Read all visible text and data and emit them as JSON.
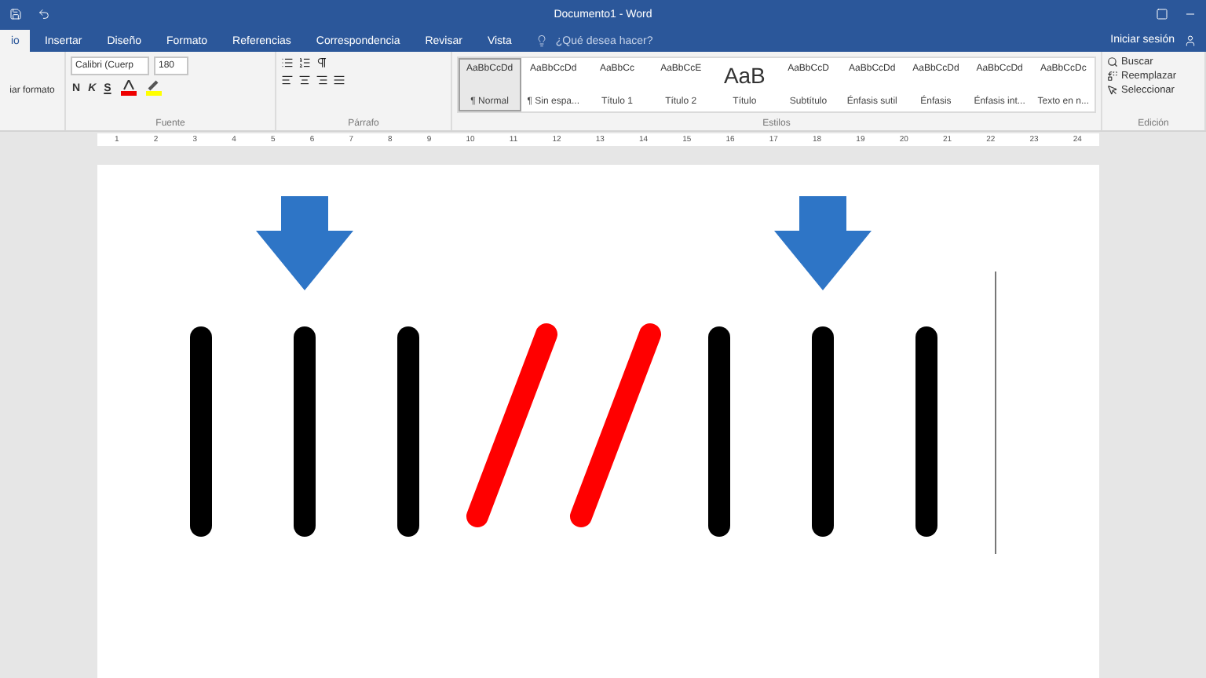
{
  "window": {
    "title": "Documento1 - Word"
  },
  "tabs": [
    {
      "label": "io",
      "selected": true
    },
    {
      "label": "Insertar",
      "selected": false
    },
    {
      "label": "Diseño",
      "selected": false
    },
    {
      "label": "Formato",
      "selected": false
    },
    {
      "label": "Referencias",
      "selected": false
    },
    {
      "label": "Correspondencia",
      "selected": false
    },
    {
      "label": "Revisar",
      "selected": false
    },
    {
      "label": "Vista",
      "selected": false
    }
  ],
  "tell_me": {
    "placeholder": "¿Qué desea hacer?"
  },
  "sign_in": "Iniciar sesión",
  "clipboard": {
    "copy_format": "iar formato"
  },
  "font": {
    "family": "Calibri (Cuerp",
    "size": "180",
    "bold": "N",
    "italic": "K",
    "underline": "S",
    "label": "Fuente"
  },
  "paragraph": {
    "label": "Párrafo"
  },
  "styles": {
    "label": "Estilos",
    "items": [
      {
        "preview": "AaBbCcDd",
        "name": "¶ Normal",
        "selected": true
      },
      {
        "preview": "AaBbCcDd",
        "name": "¶ Sin espa...",
        "selected": false
      },
      {
        "preview": "AaBbCc",
        "name": "Título 1",
        "selected": false
      },
      {
        "preview": "AaBbCcE",
        "name": "Título 2",
        "selected": false
      },
      {
        "preview": "AaB",
        "name": "Título",
        "selected": false
      },
      {
        "preview": "AaBbCcD",
        "name": "Subtítulo",
        "selected": false
      },
      {
        "preview": "AaBbCcDd",
        "name": "Énfasis sutil",
        "selected": false
      },
      {
        "preview": "AaBbCcDd",
        "name": "Énfasis",
        "selected": false
      },
      {
        "preview": "AaBbCcDd",
        "name": "Énfasis int...",
        "selected": false
      },
      {
        "preview": "AaBbCcDc",
        "name": "Texto en n...",
        "selected": false
      }
    ]
  },
  "editing": {
    "label": "Edición",
    "items": [
      "Buscar",
      "Reemplazar",
      "Seleccionar"
    ]
  },
  "ruler": [
    "1",
    "2",
    "3",
    "4",
    "5",
    "6",
    "7",
    "8",
    "9",
    "10",
    "11",
    "12",
    "13",
    "14",
    "15",
    "16",
    "17",
    "18",
    "19",
    "20",
    "21",
    "22",
    "23",
    "24"
  ],
  "marks": [
    {
      "kind": "upright",
      "color": "#000000",
      "arrow_above": false
    },
    {
      "kind": "upright",
      "color": "#000000",
      "arrow_above": true
    },
    {
      "kind": "upright",
      "color": "#000000",
      "arrow_above": false
    },
    {
      "kind": "slash",
      "color": "#ff0000",
      "arrow_above": false
    },
    {
      "kind": "slash",
      "color": "#ff0000",
      "arrow_above": false
    },
    {
      "kind": "upright",
      "color": "#000000",
      "arrow_above": false
    },
    {
      "kind": "upright",
      "color": "#000000",
      "arrow_above": true
    },
    {
      "kind": "upright",
      "color": "#000000",
      "arrow_above": false
    }
  ]
}
